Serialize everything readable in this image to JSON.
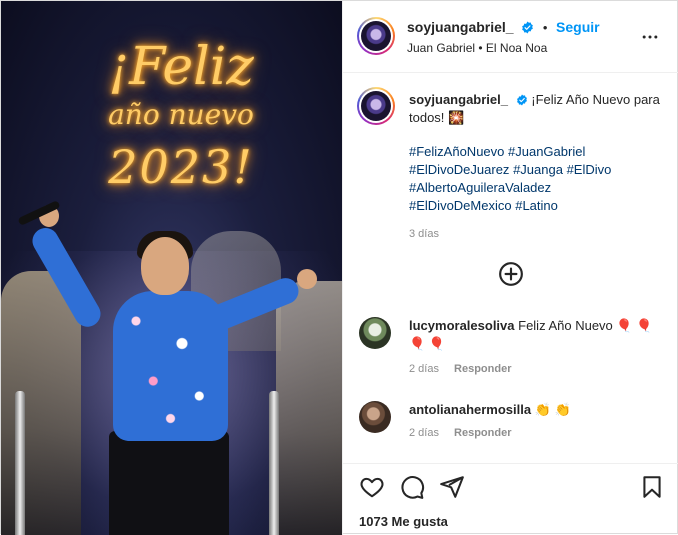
{
  "media": {
    "greeting_line1": "¡Feliz",
    "greeting_line2": "año nuevo",
    "greeting_line3": "2023!"
  },
  "header": {
    "username": "soyjuangabriel_",
    "separator": "•",
    "follow_label": "Seguir",
    "subtitle": "Juan Gabriel • El Noa Noa"
  },
  "caption": {
    "username": "soyjuangabriel_",
    "text": "¡Feliz Año Nuevo para todos! 🎇",
    "hashtags": [
      "#FelizAñoNuevo",
      "#JuanGabriel",
      "#ElDivoDeJuarez",
      "#Juanga",
      "#ElDivo",
      "#AlbertoAguileraValadez",
      "#ElDivoDeMexico",
      "#Latino"
    ],
    "time": "3 días"
  },
  "comments": [
    {
      "username": "lucymoralesoliva",
      "text": "Feliz Año Nuevo 🎈 🎈 🎈 🎈",
      "time": "2 días",
      "reply_label": "Responder"
    },
    {
      "username": "antolianahermosilla",
      "text": "👏 👏",
      "time": "2 días",
      "reply_label": "Responder"
    }
  ],
  "footer": {
    "likes": "1073 Me gusta"
  },
  "colors": {
    "accent": "#0095f6",
    "hashtag": "#00376b",
    "muted": "#8e8e8e",
    "glow": "#ffcc66"
  },
  "icons": [
    "more-icon",
    "verified-icon",
    "add-comment-icon",
    "heart-icon",
    "comment-icon",
    "share-icon",
    "bookmark-icon"
  ]
}
